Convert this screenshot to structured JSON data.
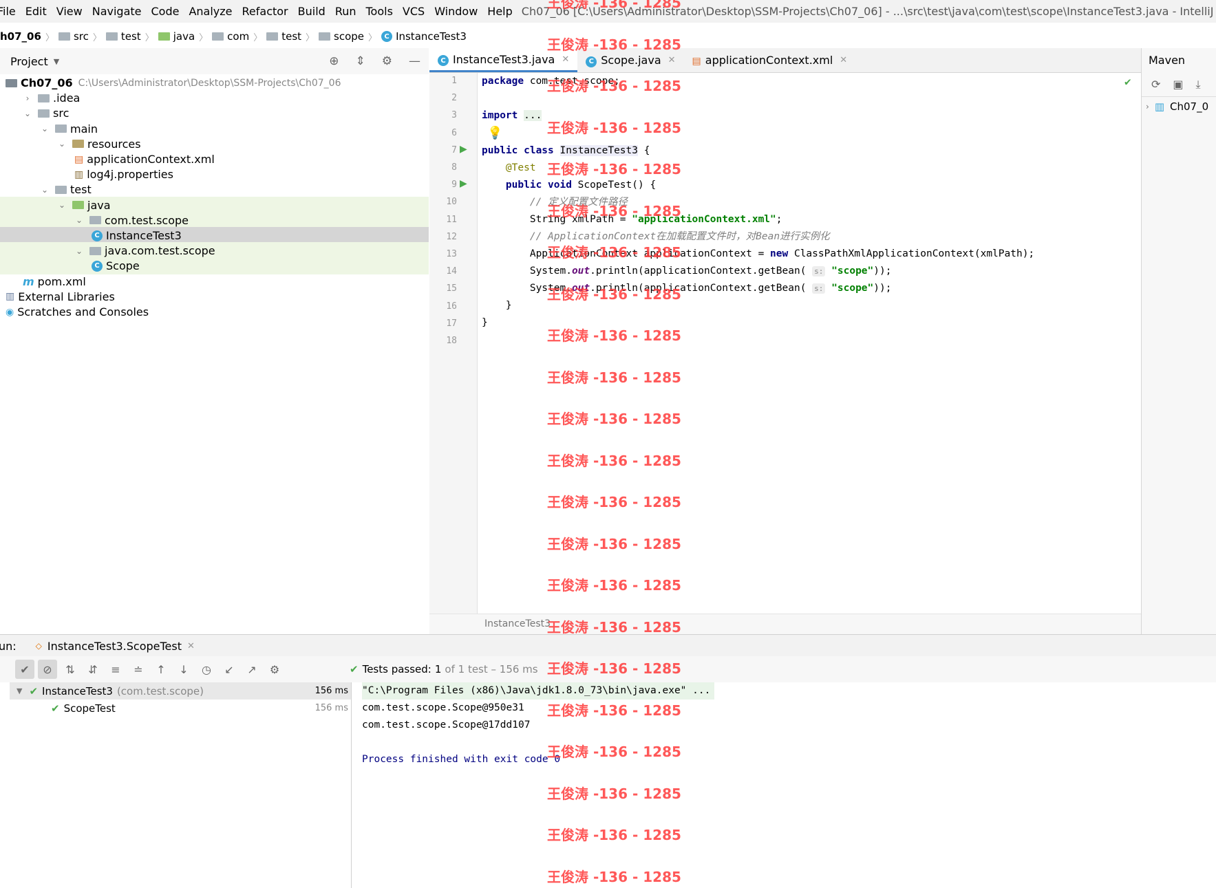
{
  "menu": [
    "File",
    "Edit",
    "View",
    "Navigate",
    "Code",
    "Analyze",
    "Refactor",
    "Build",
    "Run",
    "Tools",
    "VCS",
    "Window",
    "Help"
  ],
  "window_title": "Ch07_06 [C:\\Users\\Administrator\\Desktop\\SSM-Projects\\Ch07_06] - ...\\src\\test\\java\\com\\test\\scope\\InstanceTest3.java - IntelliJ IDEA (Adminis",
  "breadcrumb": [
    "h07_06",
    "src",
    "test",
    "java",
    "com",
    "test",
    "scope",
    "InstanceTest3"
  ],
  "project_panel": {
    "title": "Project",
    "tree": [
      {
        "label": "Ch07_06",
        "path": "C:\\Users\\Administrator\\Desktop\\SSM-Projects\\Ch07_06",
        "depth": 0,
        "arrow": "",
        "icon": "module-folder-icon",
        "style": "bold"
      },
      {
        "label": ".idea",
        "depth": 1,
        "arrow": "right",
        "icon": "folder-icon"
      },
      {
        "label": "src",
        "depth": 1,
        "arrow": "down",
        "icon": "folder-icon"
      },
      {
        "label": "main",
        "depth": 2,
        "arrow": "down",
        "icon": "folder-icon"
      },
      {
        "label": "resources",
        "depth": 3,
        "arrow": "down",
        "icon": "resources-folder-icon"
      },
      {
        "label": "applicationContext.xml",
        "depth": 4,
        "arrow": "",
        "icon": "xml-file-icon"
      },
      {
        "label": "log4j.properties",
        "depth": 4,
        "arrow": "",
        "icon": "properties-file-icon"
      },
      {
        "label": "test",
        "depth": 2,
        "arrow": "down",
        "icon": "folder-icon"
      },
      {
        "label": "java",
        "depth": 3,
        "arrow": "down",
        "icon": "test-source-folder-icon",
        "hl": "grn"
      },
      {
        "label": "com.test.scope",
        "depth": 4,
        "arrow": "down",
        "icon": "package-icon",
        "hl": "grn"
      },
      {
        "label": "InstanceTest3",
        "depth": 5,
        "arrow": "",
        "icon": "java-class-icon",
        "hl": "sel"
      },
      {
        "label": "java.com.test.scope",
        "depth": 4,
        "arrow": "down",
        "icon": "package-icon",
        "hl": "grn"
      },
      {
        "label": "Scope",
        "depth": 5,
        "arrow": "",
        "icon": "java-class-icon",
        "hl": "grn"
      },
      {
        "label": "pom.xml",
        "depth": 1,
        "arrow": "",
        "icon": "maven-icon"
      },
      {
        "label": "External Libraries",
        "depth": 0,
        "arrow": "",
        "icon": "libraries-icon"
      },
      {
        "label": "Scratches and Consoles",
        "depth": 0,
        "arrow": "",
        "icon": "scratches-icon"
      }
    ]
  },
  "editor": {
    "tabs": [
      {
        "label": "InstanceTest3.java",
        "icon": "java-class-icon",
        "active": true
      },
      {
        "label": "Scope.java",
        "icon": "java-class-icon",
        "active": false
      },
      {
        "label": "applicationContext.xml",
        "icon": "xml-file-icon",
        "active": false
      }
    ],
    "line_numbers": [
      "1",
      "2",
      "3",
      "6",
      "7",
      "8",
      "9",
      "10",
      "11",
      "12",
      "13",
      "14",
      "15",
      "16",
      "17",
      "18"
    ],
    "footer": "InstanceTest3"
  },
  "maven": {
    "title": "Maven",
    "project": "Ch07_0"
  },
  "run": {
    "label": "un:",
    "tab": "InstanceTest3.ScopeTest",
    "status_prefix": "Tests passed:",
    "status_count": "1",
    "status_suffix": "of 1 test – 156 ms",
    "tree": [
      {
        "label": "InstanceTest3",
        "sub": "(com.test.scope)",
        "time": "156 ms"
      },
      {
        "label": "ScopeTest",
        "sub": "",
        "time": "156 ms"
      }
    ],
    "console": [
      "\"C:\\Program Files (x86)\\Java\\jdk1.8.0_73\\bin\\java.exe\" ...",
      "com.test.scope.Scope@950e31",
      "com.test.scope.Scope@17dd107",
      "",
      "Process finished with exit code 0"
    ]
  },
  "watermark": "王俊涛 -136 - 1285"
}
